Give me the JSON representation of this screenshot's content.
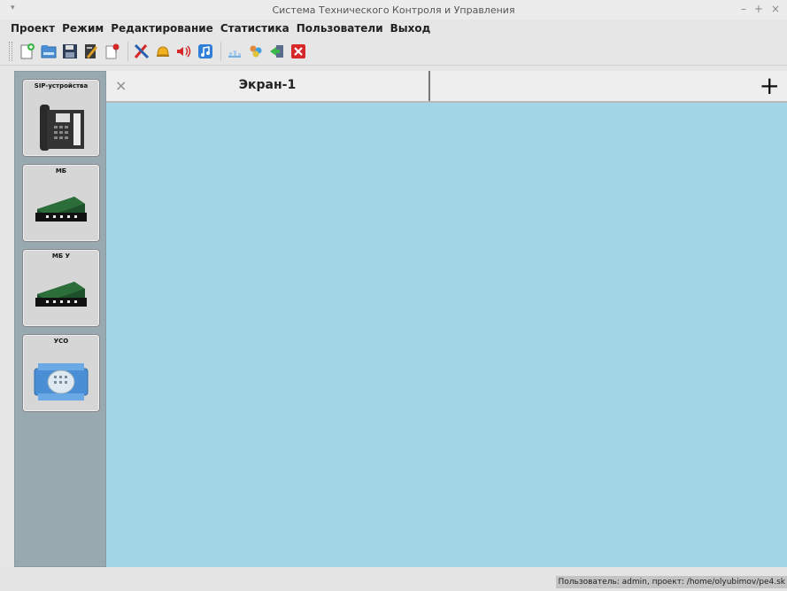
{
  "window": {
    "title": "Система Технического Контроля и Управления",
    "menu_glyph": "▾",
    "controls": [
      "–",
      "+",
      "×"
    ]
  },
  "menu": {
    "items": [
      "Проект",
      "Режим",
      "Редактирование",
      "Статистика",
      "Пользователи",
      "Выход"
    ]
  },
  "toolbar": {
    "icons": [
      "new-file-icon",
      "open-folder-icon",
      "save-icon",
      "edit-doc-icon",
      "pin-doc-icon",
      "tools-icon",
      "bell-icon",
      "sound-icon",
      "music-icon",
      "chart-icon",
      "users-icon",
      "import-icon",
      "close-red-icon"
    ]
  },
  "sidebar": {
    "devices": [
      {
        "label": "SIP-устройства",
        "icon": "desk-phone-icon"
      },
      {
        "label": "МБ",
        "icon": "rack-module-icon"
      },
      {
        "label": "МБ У",
        "icon": "rack-module-icon"
      },
      {
        "label": "УСО",
        "icon": "io-module-icon"
      }
    ]
  },
  "tabs": {
    "items": [
      {
        "label": "Экран-1"
      }
    ],
    "close_glyph": "×",
    "add_glyph": "+"
  },
  "status": {
    "text": "Пользователь: admin, проект: /home/olyubimov/pe4.sk"
  },
  "colors": {
    "canvas": "#a2d6e6",
    "sidebar": "#99a9b0"
  }
}
